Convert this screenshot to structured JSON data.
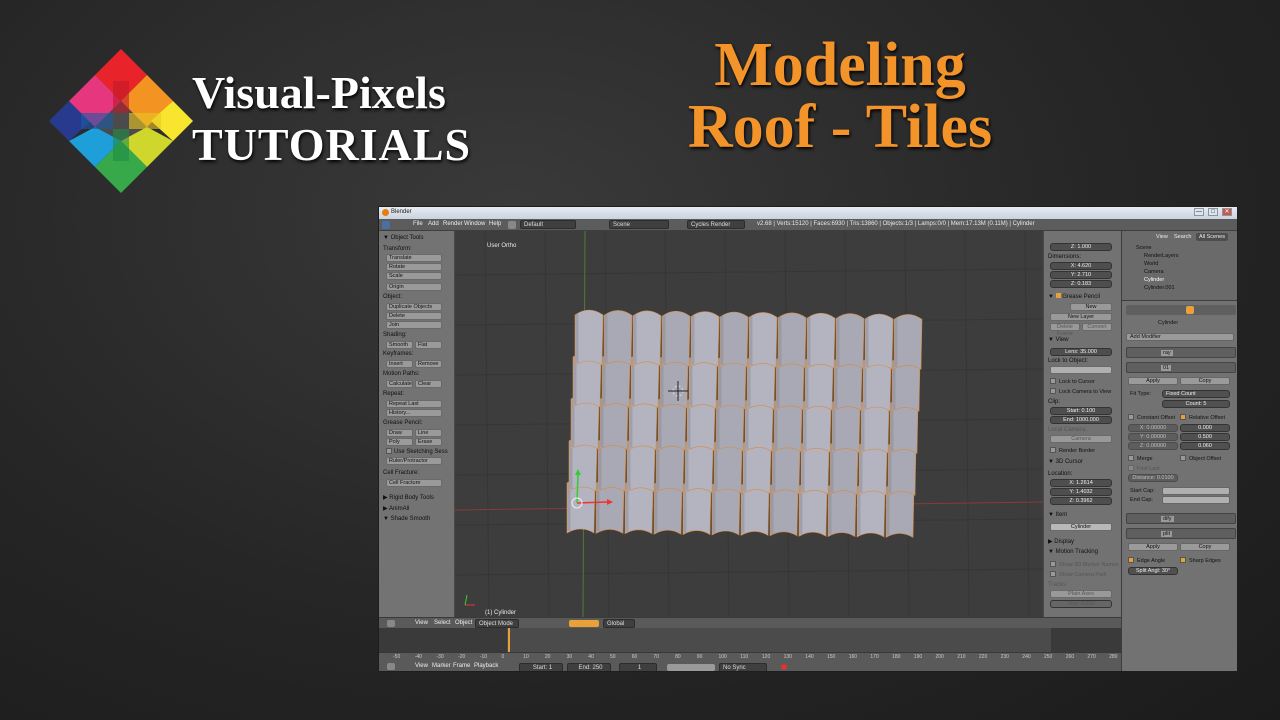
{
  "branding": {
    "line1": "Visual-Pixels",
    "line2": "TUTORIALS"
  },
  "tutorial_title": {
    "line1": "Modeling",
    "line2": "Roof - Tiles"
  },
  "colors": {
    "title_orange": "#f3942a",
    "bg": "#262626",
    "blender_grey": "#727272",
    "viewport": "#3d3d3d",
    "selected_orange": "#e8a03a"
  },
  "window": {
    "title": "Blender",
    "controls": [
      "—",
      "□",
      "✕"
    ]
  },
  "menubar": {
    "menus": [
      "File",
      "Add",
      "Render",
      "Window",
      "Help"
    ],
    "layout": "Default",
    "scene": "Scene",
    "engine": "Cycles Render",
    "stats": "v2.68 | Verts:15120 | Faces:6930 | Tris:13860 | Objects:1/3 | Lamps:0/0 | Mem:17.13M (0.11M) | Cylinder"
  },
  "tools": {
    "panel_title": "▼ Object Tools",
    "transform_hdr": "Transform:",
    "translate": "Translate",
    "rotate": "Rotate",
    "scale": "Scale",
    "origin": "Origin",
    "object_hdr": "Object:",
    "duplicate": "Duplicate Objects",
    "delete": "Delete",
    "join": "Join",
    "shading_hdr": "Shading:",
    "smooth": "Smooth",
    "flat": "Flat",
    "keyframes_hdr": "Keyframes:",
    "insert": "Insert",
    "remove": "Remove",
    "motion_hdr": "Motion Paths:",
    "calculate": "Calculate",
    "clear": "Clear",
    "repeat_hdr": "Repeat:",
    "repeat_last": "Repeat Last",
    "history": "History...",
    "grease_hdr": "Grease Pencil:",
    "draw": "Draw",
    "line": "Line",
    "poly": "Poly",
    "erase": "Erase",
    "sketch": "Use Sketching Sess",
    "ruler": "Ruler/Protractor",
    "cell_hdr": "Cell Fracture:",
    "cell": "Cell Fracture",
    "rigid": "▶ Rigid Body Tools",
    "animall": "▶ AnimAll",
    "shade": "▼ Shade Smooth"
  },
  "viewport": {
    "view_label": "User Ortho",
    "object_label": "(1) Cylinder"
  },
  "npanel": {
    "z_scale": "Z: 1.000",
    "dims_hdr": "Dimensions:",
    "dim_x": "X: 4.620",
    "dim_y": "Y: 2.710",
    "dim_z": "Z: 0.183",
    "grease_hdr": "Grease Pencil",
    "new": "New",
    "new_layer": "New Layer",
    "delete_frame": "Delete Frame",
    "convert": "Convert",
    "view_hdr": "View",
    "lens": "Lens: 35.000",
    "lock_obj": "Lock to Object:",
    "lock_cursor": "Lock to Cursor",
    "lock_cam": "Lock Camera to View",
    "clip_hdr": "Clip:",
    "clip_start": "Start: 0.100",
    "clip_end": "End: 1000.000",
    "local_cam_hdr": "Local Camera:",
    "camera": "Camera",
    "render_border": "Render Border",
    "cursor_hdr": "3D Cursor",
    "location_hdr": "Location:",
    "cur_x": "X: 1.2614",
    "cur_y": "Y: 1.4032",
    "cur_z": "Z: 0.3962",
    "item_hdr": "Item",
    "item_name": "Cylinder",
    "display_hdr": "Display",
    "motion_hdr": "Motion Tracking",
    "show_3d": "Show 3D Marker Names",
    "show_cam": "Show Camera Path",
    "tracks_hdr": "Tracks:",
    "plain_axes": "Plain Axes",
    "size": "Size: 0.200"
  },
  "outliner": {
    "view": "View",
    "search": "Search",
    "all_scenes": "All Scenes",
    "items": [
      "Scene",
      "RenderLayers",
      "World",
      "Camera",
      "Cylinder",
      "Cylinder.001"
    ]
  },
  "properties": {
    "object": "Cylinder",
    "add_modifier": "Add Modifier",
    "mod1": "ray",
    "mod2": "01",
    "apply": "Apply",
    "copy": "Copy",
    "fit_type_label": "Fit Type:",
    "fit_type": "Fixed Count",
    "count": "Count: 5",
    "constant": "Constant Offset",
    "relative": "Relative Offset",
    "c_x": "X: 0.00000",
    "c_y": "Y: 0.00000",
    "c_z": "Z: 0.00000",
    "r_x": "0.000",
    "r_y": "0.500",
    "r_z": "0.060",
    "merge": "Merge",
    "object_offset": "Object Offset",
    "first_last": "First Last",
    "distance": "Distance: 0.0100",
    "start_cap": "Start Cap:",
    "end_cap": "End Cap:",
    "mod3": "dify",
    "mod4": "plit",
    "edge_angle": "Edge Angle",
    "sharp_edges": "Sharp Edges",
    "split_angle": "Split Angl: 30°"
  },
  "viewheader": {
    "view": "View",
    "select": "Select",
    "object": "Object",
    "mode": "Object Mode",
    "orient": "Global"
  },
  "timeline": {
    "ticks": [
      "-50",
      "-40",
      "-30",
      "-20",
      "-10",
      "0",
      "10",
      "20",
      "30",
      "40",
      "50",
      "60",
      "70",
      "80",
      "90",
      "100",
      "110",
      "120",
      "130",
      "140",
      "150",
      "160",
      "170",
      "180",
      "190",
      "200",
      "210",
      "220",
      "230",
      "240",
      "250",
      "260",
      "270",
      "280"
    ],
    "view": "View",
    "marker": "Marker",
    "frame": "Frame",
    "playback": "Playback",
    "start": "Start: 1",
    "end": "End: 250",
    "current": "1",
    "sync": "No Sync"
  }
}
